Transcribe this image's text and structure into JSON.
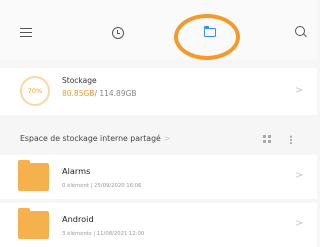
{
  "storage": {
    "percent_label": "70%",
    "title": "Stockage",
    "used": "80.85GB",
    "total": "/ 114.89GB"
  },
  "section": {
    "title": "Espace de stockage interne partagé",
    "chevron": ">"
  },
  "files": [
    {
      "name": "Alarms",
      "meta": "0 élément | 25/09/2020 16:06"
    },
    {
      "name": "Android",
      "meta": "3 éléments | 11/08/2021 12:00"
    }
  ],
  "chevron": ">",
  "colors": {
    "accent": "#f39a2e",
    "folder": "#f6b14e",
    "active_tab_icon": "#2f8ff5"
  },
  "icons": [
    "menu-icon",
    "clock-icon",
    "folder-icon",
    "search-icon",
    "grid-icon",
    "more-icon"
  ]
}
